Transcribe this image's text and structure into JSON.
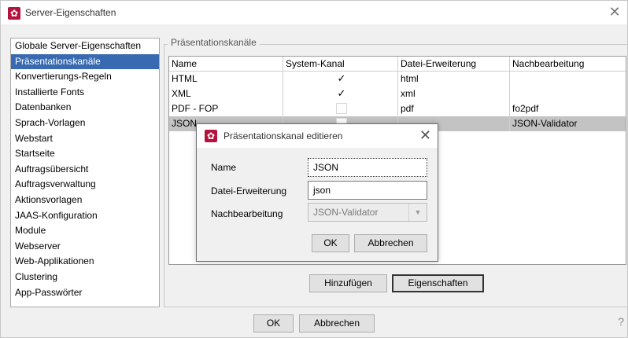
{
  "window": {
    "title": "Server-Eigenschaften",
    "close_glyph": "✕",
    "help_glyph": "?"
  },
  "nav": {
    "items": [
      {
        "label": "Globale Server-Eigenschaften",
        "selected": false
      },
      {
        "label": "Präsentationskanäle",
        "selected": true
      },
      {
        "label": "Konvertierungs-Regeln",
        "selected": false
      },
      {
        "label": "Installierte Fonts",
        "selected": false
      },
      {
        "label": "Datenbanken",
        "selected": false
      },
      {
        "label": "Sprach-Vorlagen",
        "selected": false
      },
      {
        "label": "Webstart",
        "selected": false
      },
      {
        "label": "Startseite",
        "selected": false
      },
      {
        "label": "Auftragsübersicht",
        "selected": false
      },
      {
        "label": "Auftragsverwaltung",
        "selected": false
      },
      {
        "label": "Aktionsvorlagen",
        "selected": false
      },
      {
        "label": "JAAS-Konfiguration",
        "selected": false
      },
      {
        "label": "Module",
        "selected": false
      },
      {
        "label": "Webserver",
        "selected": false
      },
      {
        "label": "Web-Applikationen",
        "selected": false
      },
      {
        "label": "Clustering",
        "selected": false
      },
      {
        "label": "App-Passwörter",
        "selected": false
      }
    ]
  },
  "panel": {
    "group_title": "Präsentationskanäle",
    "table": {
      "columns": [
        "Name",
        "System-Kanal",
        "Datei-Erweiterung",
        "Nachbearbeitung"
      ],
      "rows": [
        {
          "name": "HTML",
          "system": true,
          "ext": "html",
          "post": ""
        },
        {
          "name": "XML",
          "system": true,
          "ext": "xml",
          "post": ""
        },
        {
          "name": "PDF - FOP",
          "system": false,
          "ext": "pdf",
          "post": "fo2pdf"
        },
        {
          "name": "JSON",
          "system": false,
          "ext": "",
          "post": "JSON-Validator"
        }
      ],
      "check_glyph": "✓"
    },
    "add_button": "Hinzufügen",
    "properties_button": "Eigenschaften"
  },
  "footer": {
    "ok": "OK",
    "cancel": "Abbrechen"
  },
  "dialog": {
    "title": "Präsentationskanal editieren",
    "close_glyph": "✕",
    "name_label": "Name",
    "name_value": "JSON",
    "ext_label": "Datei-Erweiterung",
    "ext_value": "json",
    "post_label": "Nachbearbeitung",
    "post_value": "JSON-Validator",
    "ok": "OK",
    "cancel": "Abbrechen"
  },
  "icons": {
    "app_icon": "gear-icon",
    "app_icon_glyph": "✿",
    "brand_color": "#b5123e",
    "selection_color": "#396ab1"
  }
}
